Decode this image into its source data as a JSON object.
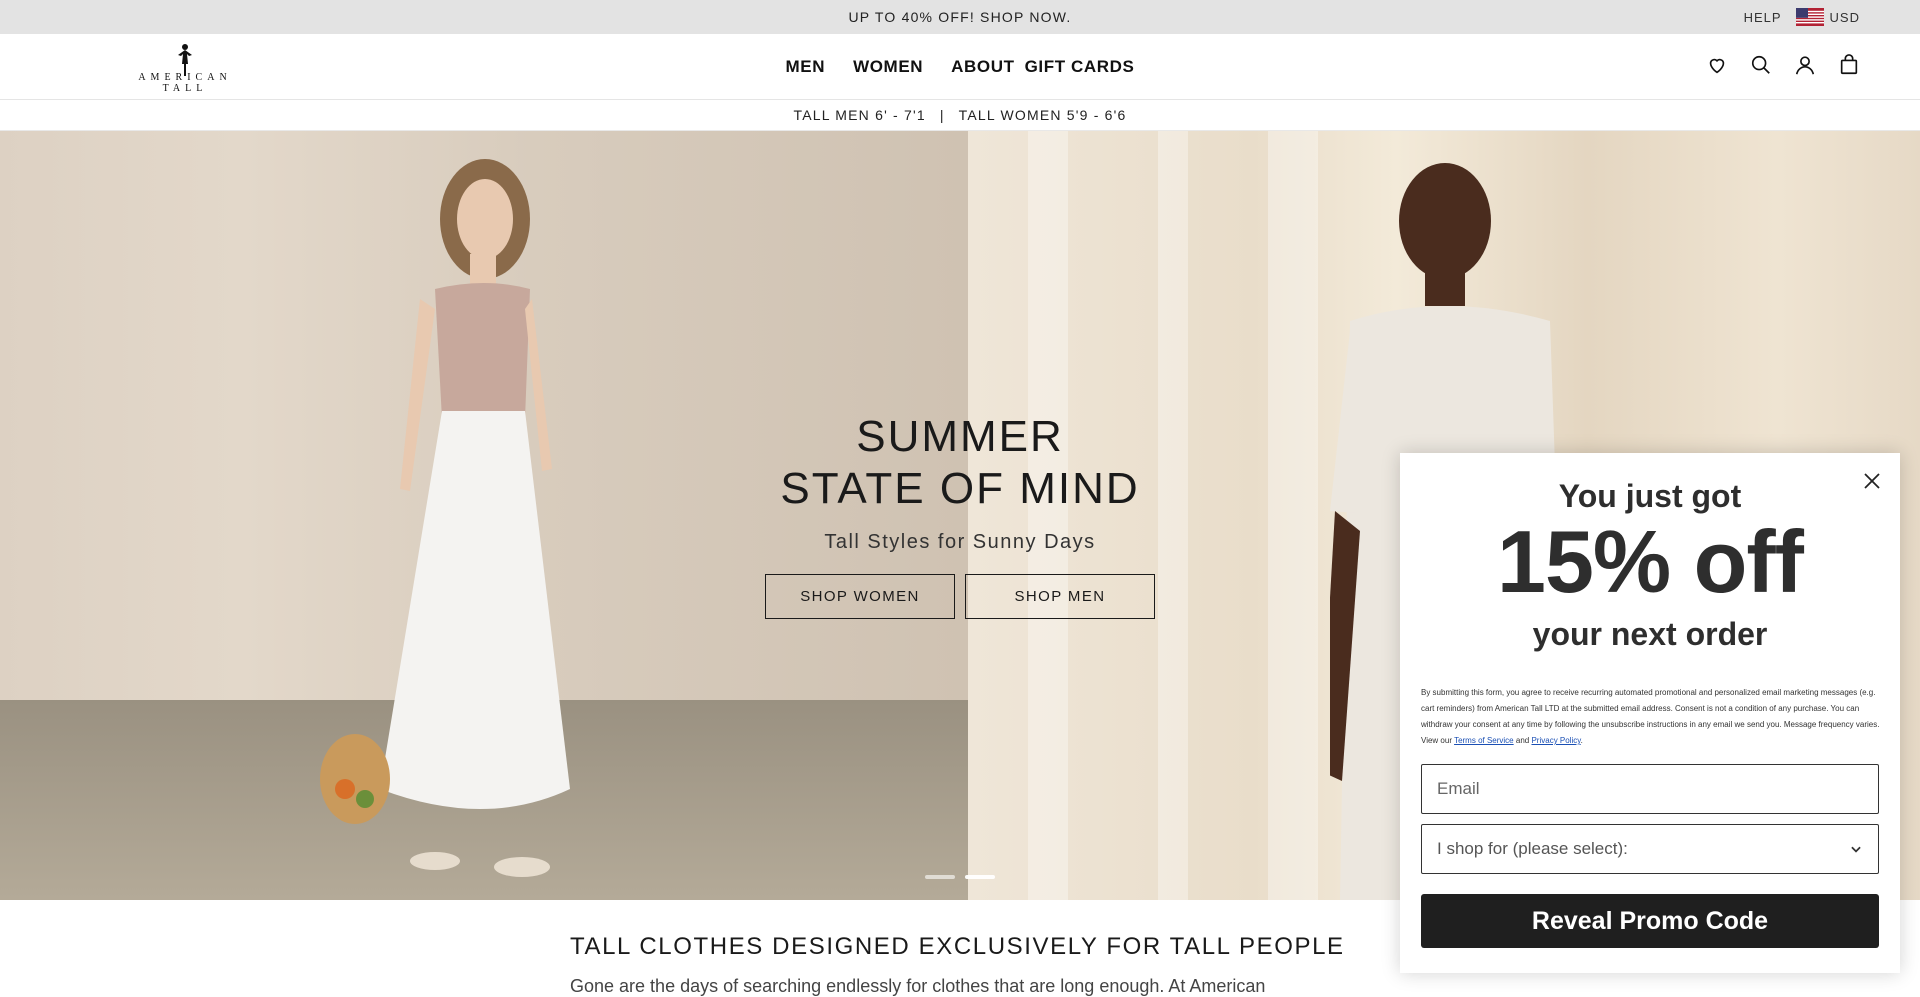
{
  "promo_bar": {
    "text": "UP TO 40% OFF! SHOP NOW.",
    "help_label": "HELP",
    "currency_label": "USD",
    "flag_icon": "us-flag-icon"
  },
  "header": {
    "logo_text": "AMERICAN TALL",
    "nav": [
      {
        "label": "MEN"
      },
      {
        "label": "WOMEN"
      },
      {
        "label": "ABOUT"
      },
      {
        "label": "GIFT CARDS"
      }
    ],
    "icons": [
      "heart-icon",
      "search-icon",
      "account-icon",
      "cart-icon"
    ]
  },
  "sub_bar": {
    "men": "TALL MEN 6' - 7'1",
    "separator": "|",
    "women": "TALL WOMEN 5'9 - 6'6"
  },
  "hero": {
    "title_line1": "SUMMER",
    "title_line2": "STATE OF MIND",
    "subtitle": "Tall Styles for Sunny Days",
    "shop_women": "SHOP WOMEN",
    "shop_men": "SHOP MEN",
    "slides_total": 2,
    "active_slide": 2
  },
  "section": {
    "title": "TALL CLOTHES DESIGNED EXCLUSIVELY FOR TALL PEOPLE",
    "text": "Gone are the days of searching endlessly for clothes that are long enough. At American"
  },
  "popup": {
    "line1": "You just got",
    "line2": "15% off",
    "line3": "your next order",
    "legal_text": "By submitting this form, you agree to receive recurring automated promotional and personalized email marketing messages (e.g. cart reminders) from American Tall LTD at the submitted email address. Consent is not a condition of any purchase. You can withdraw your consent at any time by following the unsubscribe instructions in any email we send you. Message frequency varies. View our",
    "terms_label": "Terms of Service",
    "and_label": "and",
    "privacy_label": "Privacy Policy",
    "period": ".",
    "email_placeholder": "Email",
    "select_placeholder": "I shop for (please select):",
    "submit_label": "Reveal Promo Code"
  },
  "colors": {
    "promo_bg": "#e3e3e3",
    "popup_button": "#1f1f1f",
    "link": "#1a4fb4"
  }
}
